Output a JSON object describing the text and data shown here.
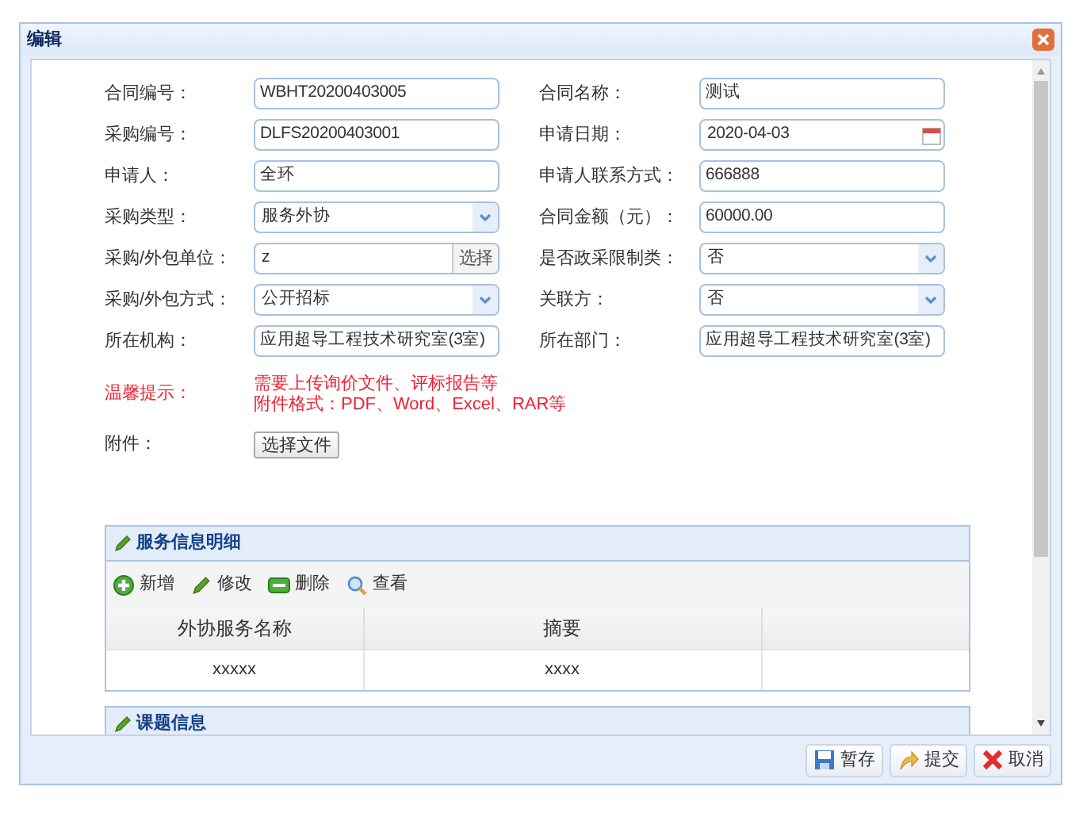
{
  "window": {
    "title": "编辑"
  },
  "fields": [
    {
      "label": "合同编号：",
      "value": "WBHT20200403005",
      "kind": "text"
    },
    {
      "label": "合同名称：",
      "value": "测试",
      "kind": "text"
    },
    {
      "label": "采购编号：",
      "value": "DLFS20200403001",
      "kind": "text"
    },
    {
      "label": "申请日期：",
      "value": "2020-04-03",
      "kind": "date"
    },
    {
      "label": "申请人：",
      "value": "全环",
      "kind": "text"
    },
    {
      "label": "申请人联系方式：",
      "value": "666888",
      "kind": "text"
    },
    {
      "label": "采购类型：",
      "value": "服务外协",
      "kind": "select"
    },
    {
      "label": "合同金额（元）：",
      "value": "60000.00",
      "kind": "text"
    },
    {
      "label": "采购/外包单位：",
      "value": "z",
      "kind": "picker",
      "button": "选择"
    },
    {
      "label": "是否政采限制类：",
      "value": "否",
      "kind": "select"
    },
    {
      "label": "采购/外包方式：",
      "value": "公开招标",
      "kind": "select"
    },
    {
      "label": "关联方：",
      "value": "否",
      "kind": "select"
    },
    {
      "label": "所在机构：",
      "value": "应用超导工程技术研究室(3室)",
      "kind": "text"
    },
    {
      "label": "所在部门：",
      "value": "应用超导工程技术研究室(3室)",
      "kind": "text"
    }
  ],
  "notice": {
    "label": "温馨提示：",
    "lines": [
      "需要上传询价文件、评标报告等",
      "附件格式：PDF、Word、Excel、RAR等"
    ]
  },
  "attachment": {
    "label": "附件：",
    "button": "选择文件"
  },
  "service_panel": {
    "title": "服务信息明细",
    "toolbar": [
      {
        "label": "新增",
        "kind": "add"
      },
      {
        "label": "修改",
        "kind": "edit"
      },
      {
        "label": "删除",
        "kind": "delete"
      },
      {
        "label": "查看",
        "kind": "view"
      }
    ],
    "columns": [
      "外协服务名称",
      "摘要"
    ],
    "rows": [
      [
        "xxxxx",
        "xxxx"
      ]
    ]
  },
  "topic_panel": {
    "title": "课题信息"
  },
  "buttons": [
    {
      "label": "暂存",
      "kind": "save"
    },
    {
      "label": "提交",
      "kind": "submit"
    },
    {
      "label": "取消",
      "kind": "cancel"
    }
  ]
}
